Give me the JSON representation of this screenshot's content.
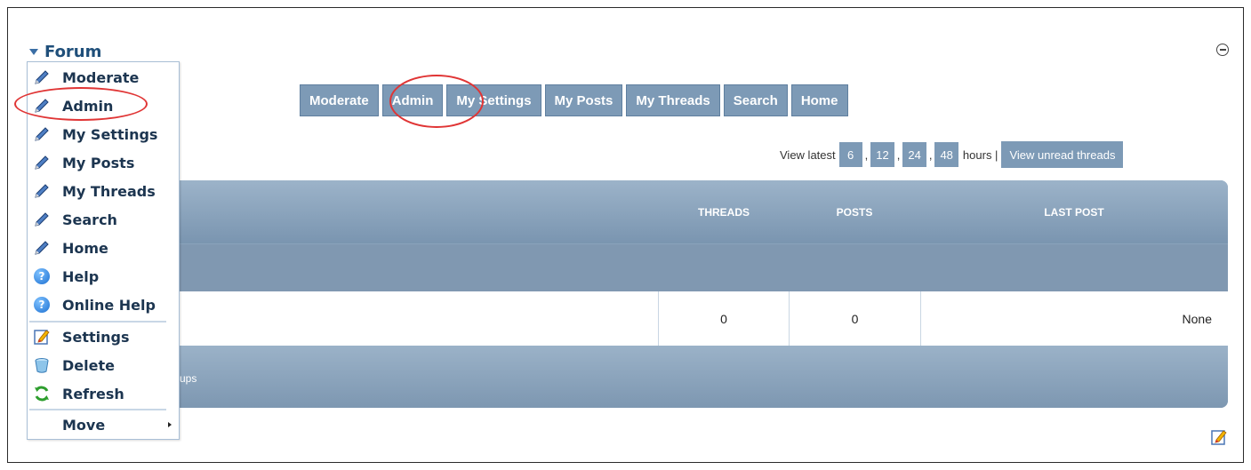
{
  "forum": {
    "title": "Forum"
  },
  "tabs": [
    {
      "label": "Moderate"
    },
    {
      "label": "Admin"
    },
    {
      "label": "My Settings"
    },
    {
      "label": "My Posts"
    },
    {
      "label": "My Threads"
    },
    {
      "label": "Search"
    },
    {
      "label": "Home"
    }
  ],
  "latest": {
    "label": "View latest",
    "hours": [
      "6",
      "12",
      "24",
      "48"
    ],
    "comma": ",",
    "suffix": "hours |",
    "unread_label": "View unread threads"
  },
  "table": {
    "columns": {
      "threads": "THREADS",
      "posts": "POSTS",
      "last_post": "LAST POST"
    },
    "row": {
      "threads": "0",
      "posts": "0",
      "last_post": "None"
    },
    "groups_fragment": "ups"
  },
  "menu": {
    "items": [
      {
        "label": "Moderate",
        "icon": "pencil-icon"
      },
      {
        "label": "Admin",
        "icon": "pencil-icon"
      },
      {
        "label": "My Settings",
        "icon": "pencil-icon"
      },
      {
        "label": "My Posts",
        "icon": "pencil-icon"
      },
      {
        "label": "My Threads",
        "icon": "pencil-icon"
      },
      {
        "label": "Search",
        "icon": "pencil-icon"
      },
      {
        "label": "Home",
        "icon": "pencil-icon"
      },
      {
        "label": "Help",
        "icon": "help-icon"
      },
      {
        "label": "Online Help",
        "icon": "help-icon"
      },
      {
        "label": "Settings",
        "icon": "settings-icon"
      },
      {
        "label": "Delete",
        "icon": "trash-icon"
      },
      {
        "label": "Refresh",
        "icon": "refresh-icon"
      },
      {
        "label": "Move",
        "icon": "chevron-right-icon"
      }
    ]
  },
  "colors": {
    "tab_bg": "#7d9ab6",
    "accent_text": "#1c3550",
    "annotation": "#e03535"
  }
}
